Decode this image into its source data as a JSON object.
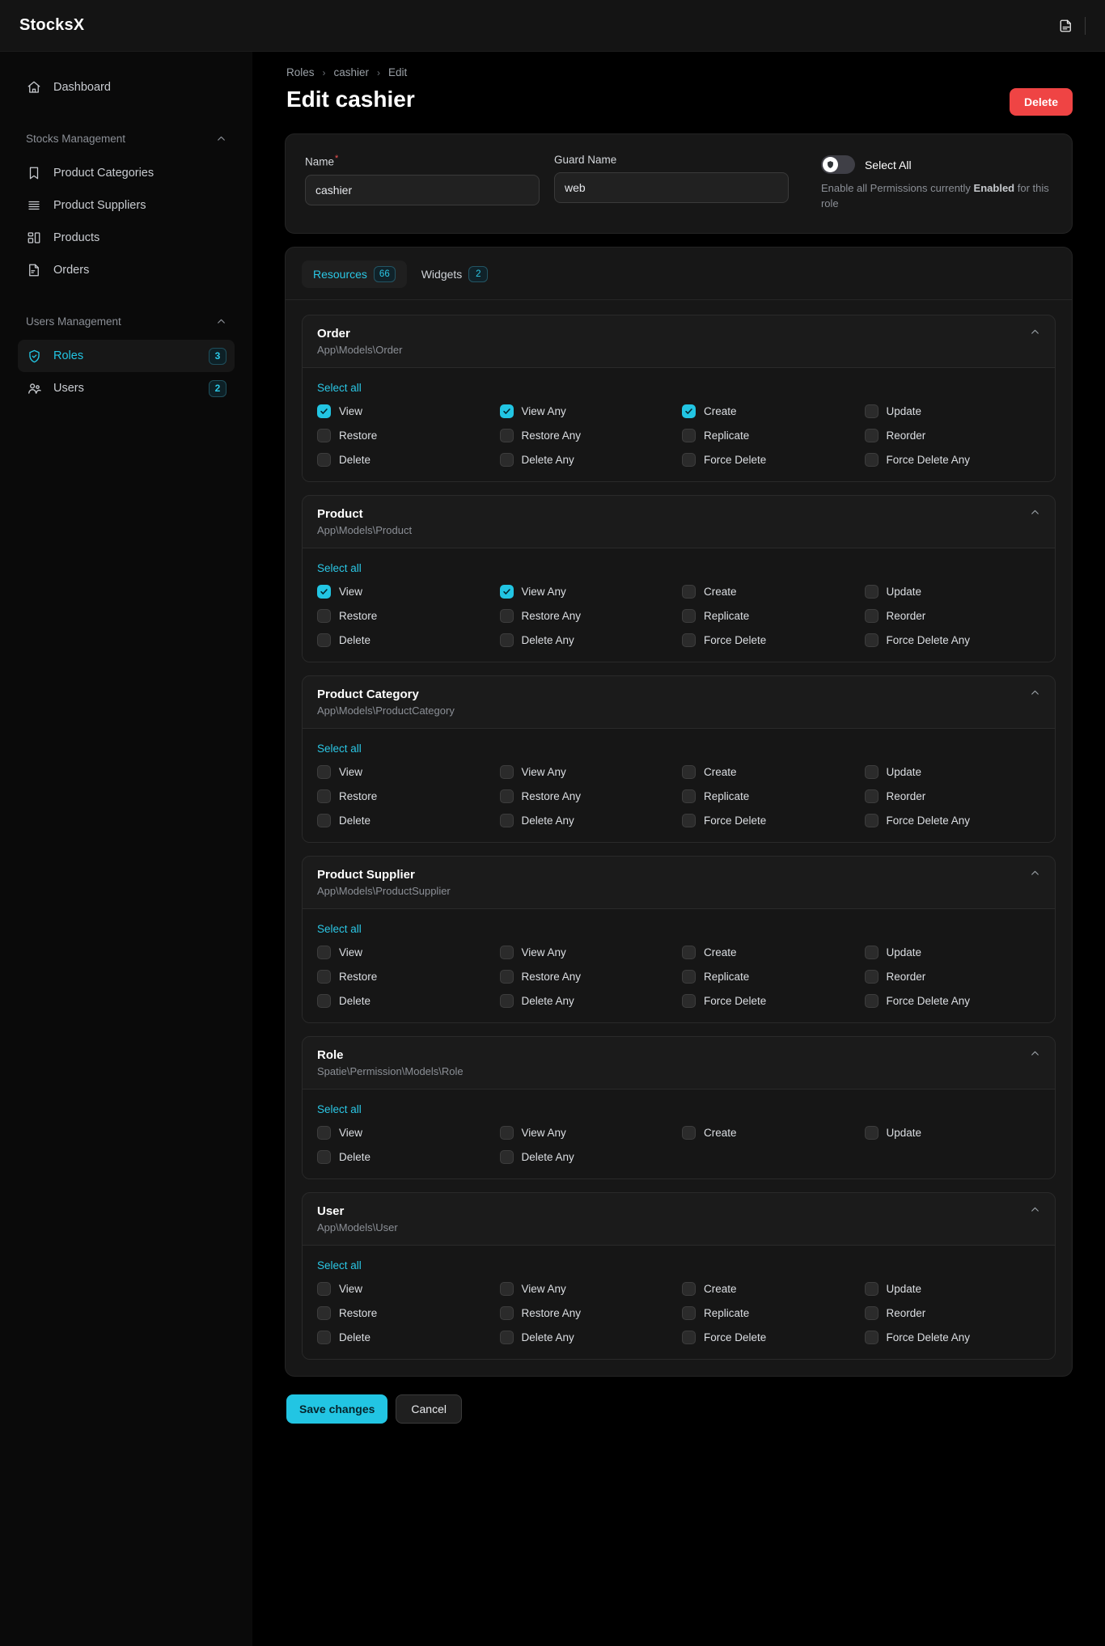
{
  "app": {
    "brand": "StocksX",
    "user_avatar_icon": "user-avatar-icon"
  },
  "sidebar": {
    "dashboard": {
      "label": "Dashboard",
      "icon": "home-icon"
    },
    "groups": [
      {
        "label": "Stocks Management",
        "chevron_icon": "chevron-up-icon",
        "items": [
          {
            "label": "Product Categories",
            "icon": "bookmark-icon",
            "badge": "",
            "active": false
          },
          {
            "label": "Product Suppliers",
            "icon": "stack-lines-icon",
            "badge": "",
            "active": false
          },
          {
            "label": "Products",
            "icon": "layout-blocks-icon",
            "badge": "",
            "active": false
          },
          {
            "label": "Orders",
            "icon": "document-icon",
            "badge": "",
            "active": false
          }
        ]
      },
      {
        "label": "Users Management",
        "chevron_icon": "chevron-up-icon",
        "items": [
          {
            "label": "Roles",
            "icon": "shield-check-icon",
            "badge": "3",
            "active": true
          },
          {
            "label": "Users",
            "icon": "users-icon",
            "badge": "2",
            "active": false
          }
        ]
      }
    ]
  },
  "breadcrumb": {
    "items": [
      "Roles",
      "cashier",
      "Edit"
    ],
    "separator": "›"
  },
  "header": {
    "title": "Edit cashier",
    "delete_label": "Delete"
  },
  "form": {
    "name": {
      "label": "Name",
      "required_marker": "*",
      "value": "cashier",
      "placeholder": ""
    },
    "guard_name": {
      "label": "Guard Name",
      "value": "web",
      "placeholder": ""
    },
    "select_all": {
      "toggle_label": "Select All",
      "toggle_state": "off",
      "knob_icon": "shield-icon",
      "help_prefix": "Enable all Permissions currently ",
      "help_strong": "Enabled",
      "help_suffix": " for this role"
    }
  },
  "tabs": [
    {
      "label": "Resources",
      "badge": "66",
      "active": true
    },
    {
      "label": "Widgets",
      "badge": "2",
      "active": false
    }
  ],
  "select_all_link_label": "Select all",
  "collapse_icon": "chevron-up-icon",
  "resources": [
    {
      "title": "Order",
      "model": "App\\Models\\Order",
      "permissions": [
        {
          "label": "View",
          "checked": true
        },
        {
          "label": "View Any",
          "checked": true
        },
        {
          "label": "Create",
          "checked": true
        },
        {
          "label": "Update",
          "checked": false
        },
        {
          "label": "Restore",
          "checked": false
        },
        {
          "label": "Restore Any",
          "checked": false
        },
        {
          "label": "Replicate",
          "checked": false
        },
        {
          "label": "Reorder",
          "checked": false
        },
        {
          "label": "Delete",
          "checked": false
        },
        {
          "label": "Delete Any",
          "checked": false
        },
        {
          "label": "Force Delete",
          "checked": false
        },
        {
          "label": "Force Delete Any",
          "checked": false
        }
      ]
    },
    {
      "title": "Product",
      "model": "App\\Models\\Product",
      "permissions": [
        {
          "label": "View",
          "checked": true
        },
        {
          "label": "View Any",
          "checked": true
        },
        {
          "label": "Create",
          "checked": false
        },
        {
          "label": "Update",
          "checked": false
        },
        {
          "label": "Restore",
          "checked": false
        },
        {
          "label": "Restore Any",
          "checked": false
        },
        {
          "label": "Replicate",
          "checked": false
        },
        {
          "label": "Reorder",
          "checked": false
        },
        {
          "label": "Delete",
          "checked": false
        },
        {
          "label": "Delete Any",
          "checked": false
        },
        {
          "label": "Force Delete",
          "checked": false
        },
        {
          "label": "Force Delete Any",
          "checked": false
        }
      ]
    },
    {
      "title": "Product Category",
      "model": "App\\Models\\ProductCategory",
      "permissions": [
        {
          "label": "View",
          "checked": false
        },
        {
          "label": "View Any",
          "checked": false
        },
        {
          "label": "Create",
          "checked": false
        },
        {
          "label": "Update",
          "checked": false
        },
        {
          "label": "Restore",
          "checked": false
        },
        {
          "label": "Restore Any",
          "checked": false
        },
        {
          "label": "Replicate",
          "checked": false
        },
        {
          "label": "Reorder",
          "checked": false
        },
        {
          "label": "Delete",
          "checked": false
        },
        {
          "label": "Delete Any",
          "checked": false
        },
        {
          "label": "Force Delete",
          "checked": false
        },
        {
          "label": "Force Delete Any",
          "checked": false
        }
      ]
    },
    {
      "title": "Product Supplier",
      "model": "App\\Models\\ProductSupplier",
      "permissions": [
        {
          "label": "View",
          "checked": false
        },
        {
          "label": "View Any",
          "checked": false
        },
        {
          "label": "Create",
          "checked": false
        },
        {
          "label": "Update",
          "checked": false
        },
        {
          "label": "Restore",
          "checked": false
        },
        {
          "label": "Restore Any",
          "checked": false
        },
        {
          "label": "Replicate",
          "checked": false
        },
        {
          "label": "Reorder",
          "checked": false
        },
        {
          "label": "Delete",
          "checked": false
        },
        {
          "label": "Delete Any",
          "checked": false
        },
        {
          "label": "Force Delete",
          "checked": false
        },
        {
          "label": "Force Delete Any",
          "checked": false
        }
      ]
    },
    {
      "title": "Role",
      "model": "Spatie\\Permission\\Models\\Role",
      "permissions": [
        {
          "label": "View",
          "checked": false
        },
        {
          "label": "View Any",
          "checked": false
        },
        {
          "label": "Create",
          "checked": false
        },
        {
          "label": "Update",
          "checked": false
        },
        {
          "label": "Delete",
          "checked": false
        },
        {
          "label": "Delete Any",
          "checked": false
        }
      ]
    },
    {
      "title": "User",
      "model": "App\\Models\\User",
      "permissions": [
        {
          "label": "View",
          "checked": false
        },
        {
          "label": "View Any",
          "checked": false
        },
        {
          "label": "Create",
          "checked": false
        },
        {
          "label": "Update",
          "checked": false
        },
        {
          "label": "Restore",
          "checked": false
        },
        {
          "label": "Restore Any",
          "checked": false
        },
        {
          "label": "Replicate",
          "checked": false
        },
        {
          "label": "Reorder",
          "checked": false
        },
        {
          "label": "Delete",
          "checked": false
        },
        {
          "label": "Delete Any",
          "checked": false
        },
        {
          "label": "Force Delete",
          "checked": false
        },
        {
          "label": "Force Delete Any",
          "checked": false
        }
      ]
    }
  ],
  "footer": {
    "save_label": "Save changes",
    "cancel_label": "Cancel"
  },
  "colors": {
    "accent": "#22c5e3",
    "danger": "#ef4444",
    "page_bg": "#000000",
    "card_bg": "#171717"
  }
}
